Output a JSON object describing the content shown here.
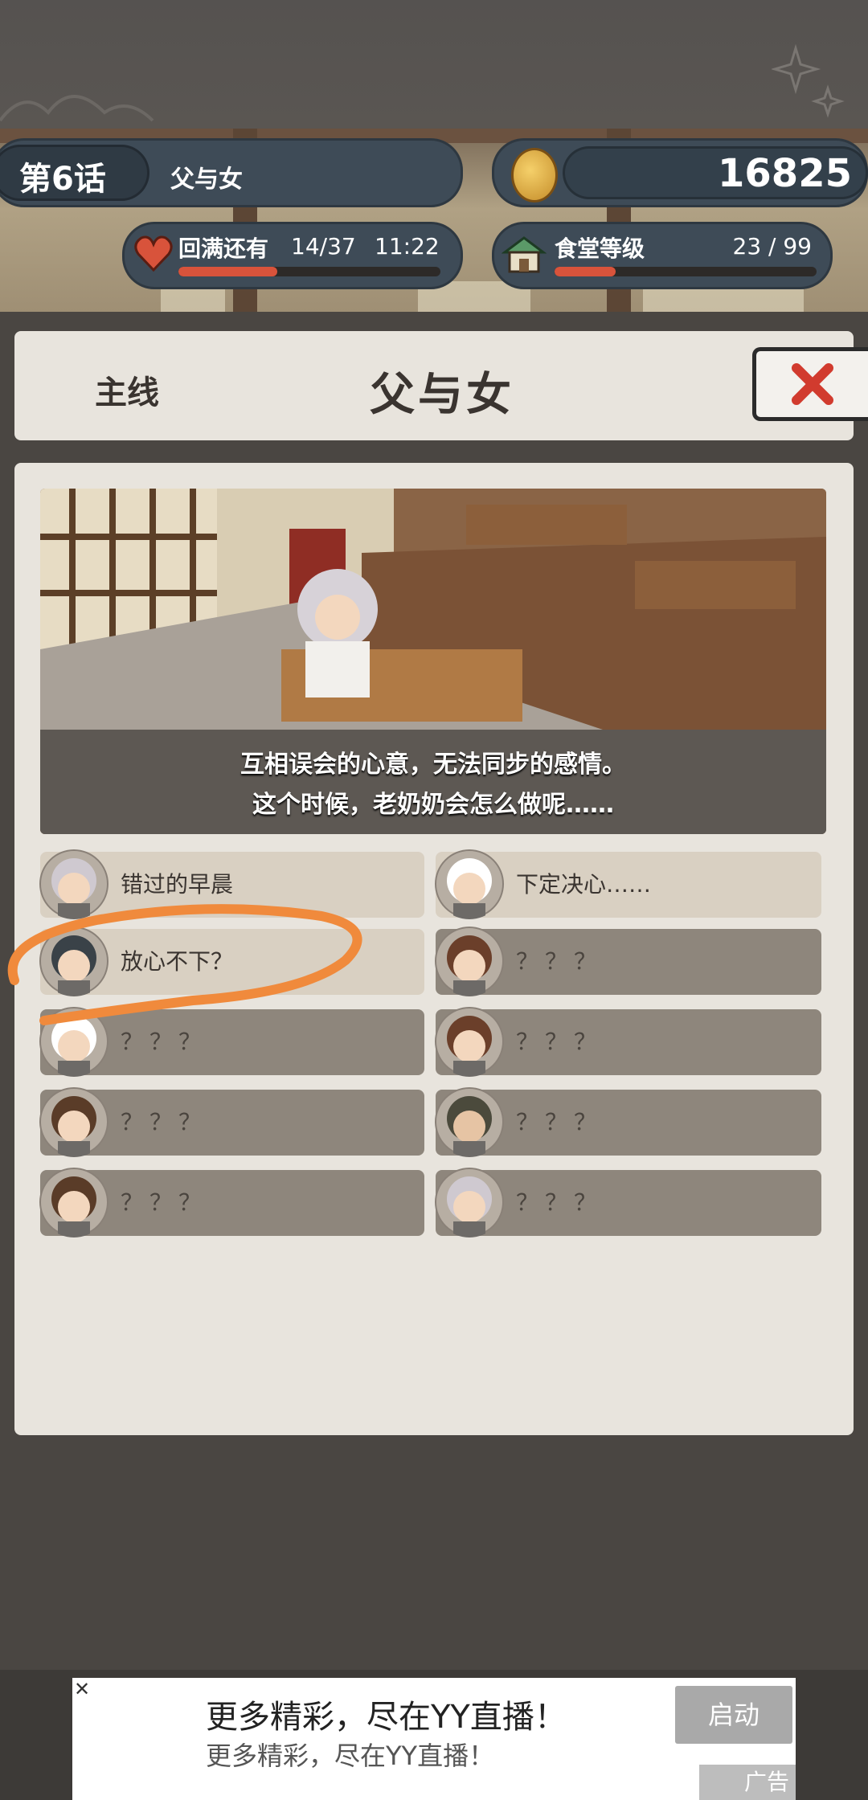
{
  "header": {
    "chapter_label": "第6话",
    "chapter_title": "父与女",
    "coins": "16825",
    "stamina_label": "回满还有",
    "stamina_value": "14/37",
    "stamina_timer": "11:22",
    "stamina_progress": 0.378,
    "canteen_label": "食堂等级",
    "canteen_value": "23 / 99",
    "canteen_progress": 0.232
  },
  "title_panel": {
    "category": "主线",
    "title": "父与女"
  },
  "scene": {
    "caption_line1": "互相误会的心意，无法同步的感情。",
    "caption_line2": "这个时候，老奶奶会怎么做呢……"
  },
  "episodes": [
    {
      "label": "错过的早晨",
      "locked": false
    },
    {
      "label": "下定决心……",
      "locked": false
    },
    {
      "label": "放心不下？",
      "locked": false
    },
    {
      "label": "？？？",
      "locked": true
    },
    {
      "label": "？？？",
      "locked": true
    },
    {
      "label": "？？？",
      "locked": true
    },
    {
      "label": "？？？",
      "locked": true
    },
    {
      "label": "？？？",
      "locked": true
    },
    {
      "label": "？？？",
      "locked": true
    },
    {
      "label": "？？？",
      "locked": true
    }
  ],
  "ad": {
    "headline": "更多精彩，尽在YY直播！",
    "subline": "更多精彩，尽在YY直播！",
    "launch_label": "启动",
    "tag": "广告"
  },
  "colors": {
    "accent_red": "#d8533b",
    "panel_bg": "#e8e4dd",
    "annotation_orange": "#f08a3c"
  }
}
